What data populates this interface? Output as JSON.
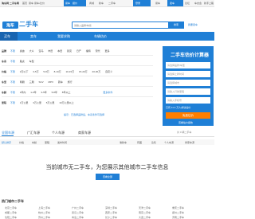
{
  "topbar": {
    "logo": "淘车网 二手车网",
    "items": [
      "首页",
      "易车",
      "易车•比价",
      "汽车",
      "新车",
      "二手车"
    ],
    "nav": [
      "易车",
      "报价",
      "商城",
      "新车",
      "二手车"
    ],
    "right": [
      "易车",
      "论坛",
      "车友会",
      "新手上路"
    ],
    "highlight": [
      "登录",
      "卖车"
    ]
  },
  "header": {
    "logo_text": "淘车",
    "title": "二手车",
    "search_placeholder": "请输入品牌/车系",
    "search_button": "搜索",
    "sell_link": "我要卖车"
  },
  "nav": {
    "items": [
      "买车",
      "卖车",
      "我要求购",
      "车辆估价"
    ]
  },
  "filters": {
    "brand": {
      "label": "品牌",
      "options": [
        "不限",
        "奥迪",
        "大众",
        "宝马",
        "丰田",
        "本田",
        "别克",
        "日产",
        "福特",
        "现代",
        "更多"
      ]
    },
    "series": {
      "label": "车系",
      "options": [
        "不限",
        "路虎",
        "车型"
      ]
    },
    "price": {
      "label": "价格",
      "options": [
        "不限",
        "3万以下",
        "3-5万",
        "5-8万",
        "8-10万",
        "10-15万",
        "15-20万",
        "20-30万",
        "自定义"
      ]
    },
    "body": {
      "label": "车型",
      "options": [
        "不限",
        "两厢",
        "三厢",
        "SUV",
        "MPV",
        "跑车",
        "旅行"
      ]
    },
    "age": {
      "label": "车龄",
      "options": [
        "不限",
        "1年内",
        "1-3年",
        "3-5年",
        "5-8年",
        "8年以上"
      ]
    },
    "mileage": {
      "label": "里程",
      "options": [
        "不限",
        "1万公里",
        "3万公里",
        "5万公里",
        "10万公里以上"
      ]
    },
    "extra": "更多条件",
    "hint": "提示：已选择品牌后，车系条件可选择"
  },
  "calculator": {
    "title": "二手车估价计算器",
    "fields": [
      "请选择品牌/车型",
      "请选择上牌时间",
      "请选择城市",
      "请输入行驶里程",
      "请输入手机号"
    ],
    "button": "免费估价",
    "note": "已有 11.4 万人成功估价",
    "link": "查看估价报告"
  },
  "tabs": {
    "items": [
      "全国车源",
      "广汇车源",
      "个人车源",
      "商家车源"
    ],
    "right": "共 0 辆二手车"
  },
  "sortbar": {
    "items": [
      "默认排序",
      "价格",
      "车龄",
      "里程",
      "发布时间"
    ],
    "options": [
      "准新车",
      "有图",
      "急售",
      "个人车源",
      "商家车源"
    ]
  },
  "empty": {
    "message": "当前城市无二手车，为您展示其他城市二手车信息",
    "button": "查看全部"
  },
  "footer": {
    "title": "热门城市二手车",
    "cities": [
      [
        "北京二手车",
        "上海二手车",
        "广州二手车",
        "深圳二手车",
        "天津二手车",
        "重庆二手车"
      ],
      [
        "成都二手车",
        "杭州二手车",
        "武汉二手车",
        "西安二手车",
        "南京二手车",
        "郑州二手车"
      ],
      [
        "沈阳二手车",
        "苏州二手车",
        "青岛二手车",
        "长沙二手车",
        "大连二手车",
        "济南二手车"
      ]
    ]
  }
}
